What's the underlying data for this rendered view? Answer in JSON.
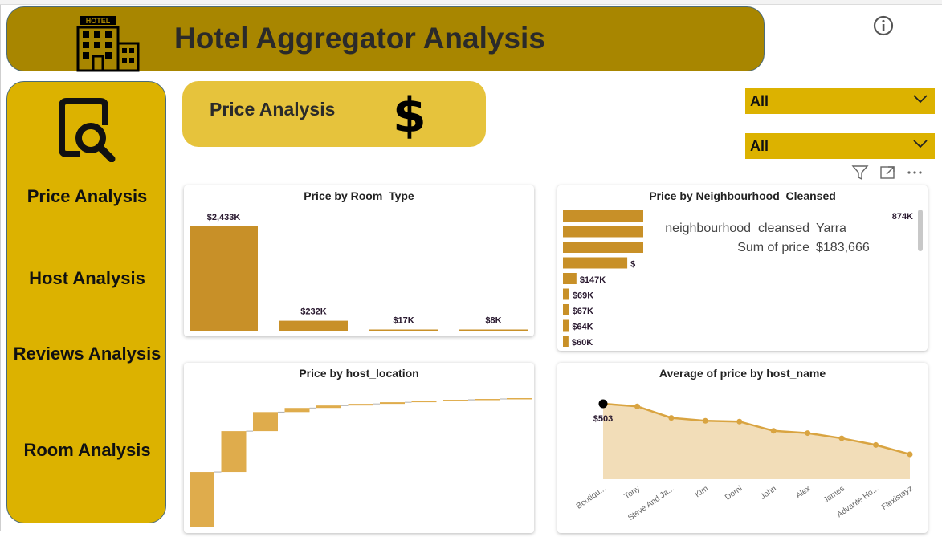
{
  "header": {
    "title": "Hotel Aggregator Analysis",
    "logo_text": "HOTEL"
  },
  "sidebar": {
    "items": [
      {
        "label": "Price Analysis"
      },
      {
        "label": "Host Analysis"
      },
      {
        "label": "Reviews Analysis"
      },
      {
        "label": "Room Analysis"
      }
    ]
  },
  "price_card": {
    "label": "Price Analysis",
    "symbol": "$"
  },
  "slicers": [
    {
      "value": "All"
    },
    {
      "value": "All"
    }
  ],
  "colors": {
    "header": "#a88600",
    "sidebar": "#dcb200",
    "bar": "#c89028",
    "waterfall": "#dfac4c",
    "total": "#252525",
    "line": "#d9a441",
    "area": "#f2ddb8"
  },
  "chart_data": [
    {
      "type": "bar",
      "title": "Price by Room_Type",
      "values": [
        2433,
        232,
        17,
        8
      ],
      "labels": [
        "$2,433K",
        "$232K",
        "$17K",
        "$8K"
      ]
    },
    {
      "type": "bar",
      "orientation": "horizontal",
      "title": "Price by Neighbourhood_Cleansed",
      "values": [
        874,
        874,
        874,
        700,
        147,
        69,
        67,
        64,
        60
      ],
      "labels": [
        "",
        "",
        "",
        "$",
        "$147K",
        "$69K",
        "$67K",
        "$64K",
        "$60K"
      ],
      "top_label": "874K",
      "tooltip": [
        {
          "key": "neighbourhood_cleansed",
          "value": "Yarra"
        },
        {
          "key": "Sum of price",
          "value": "$183,666"
        }
      ]
    },
    {
      "type": "waterfall",
      "title": "Price by host_location",
      "increments": [
        1000,
        750,
        350,
        75,
        45,
        30,
        30,
        25,
        20,
        15,
        15
      ],
      "total": 2355
    },
    {
      "type": "area",
      "title": "Average of price by host_name",
      "categories": [
        "Boutiqu...",
        "Tony",
        "Steve And Ja...",
        "Kim",
        "Domi",
        "John",
        "Alex",
        "James",
        "Advante Ho...",
        "Flexistayz"
      ],
      "values": [
        503,
        496,
        465,
        457,
        455,
        430,
        424,
        410,
        392,
        367
      ],
      "first_label": "$503"
    }
  ]
}
